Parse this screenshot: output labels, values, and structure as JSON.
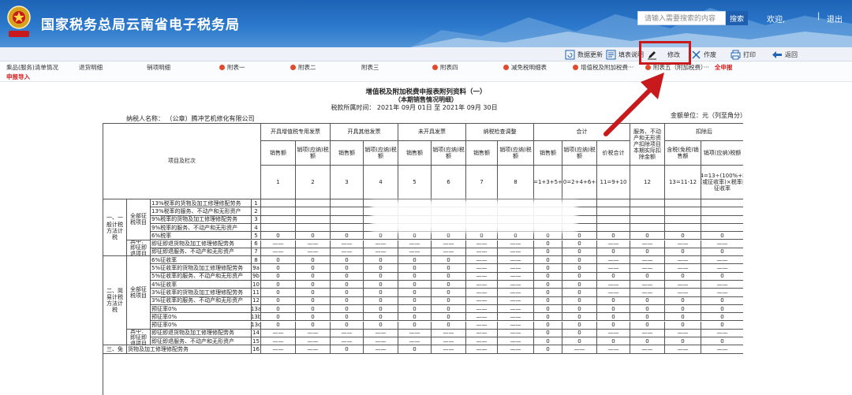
{
  "header": {
    "title": "国家税务总局云南省电子税务局",
    "search_placeholder": "请输入需要搜索的内容",
    "search_button": "搜索",
    "welcome": "欢迎,",
    "separator": "|",
    "logout": "退出",
    "colors": {
      "banner": "#2b78cc",
      "accent": "#c8191c"
    }
  },
  "toolbar": {
    "items": [
      {
        "label": "数据更新",
        "icon": "refresh-icon"
      },
      {
        "label": "填表说明",
        "icon": "doc-icon"
      },
      {
        "label": "修改",
        "icon": "edit-icon"
      },
      {
        "label": "作废",
        "icon": "void-icon"
      },
      {
        "label": "打印",
        "icon": "print-icon"
      },
      {
        "label": "返回",
        "icon": "back-icon"
      }
    ]
  },
  "tabs": {
    "items": [
      "乘品(服务)清单情况",
      "退货明细",
      "销项明细",
      "附表一",
      "附表二",
      "附表三",
      "附表四",
      "减免税明细表",
      "增值税及附加税费···",
      "附表五（附加税费）···",
      "全申报",
      "申报导入"
    ]
  },
  "document": {
    "title": "增值税及附加税费申报表附列资料（一）",
    "subtitle": "（本期销售情况明细）",
    "period": "税款所属时间： 2021年 09月 01日 至 2021年 09月 30日",
    "taxpayer": "纳税人名称： （公章）腾冲艺机修化有限公司",
    "unit": "金额单位：元（列至角分）"
  },
  "table": {
    "header_row1": [
      "开具增值税专用发票",
      "开具其他发票",
      "未开具发票",
      "纳税检查调整",
      "合计",
      "服务、不动产和无形资产扣除项目本期实际扣除金额",
      "扣除后"
    ],
    "header_row2": [
      "销售额",
      "销项(应纳)税额",
      "销售额",
      "销项(应纳)税额",
      "销售额",
      "销项(应纳)税额",
      "销售额",
      "销项(应纳)税额",
      "销售额",
      "销项(应纳)税额",
      "价税合计",
      "含税(免税)销售额",
      "销项(应纳)税额"
    ],
    "header_row3": [
      "1",
      "2",
      "3",
      "4",
      "5",
      "6",
      "7",
      "8",
      "9=1+3+5+7",
      "10=2+4+6+8",
      "11=9+10",
      "12",
      "13=11-12",
      "14=13÷(100%+税率或征收率)×税率或征收率"
    ],
    "project_header": "项目及栏次",
    "groups": [
      "一、一般计税方法计税",
      "二、简易计税方法计税",
      "三、免"
    ],
    "subgroups": [
      "全部征税项目",
      "其中：即征即退项目",
      "全部征税项目",
      "其中：即征即退项目"
    ],
    "rows": [
      {
        "label": "13%税率的货物及加工修理修配劳务",
        "no": "1",
        "cells": [
          "",
          "",
          "",
          "",
          "",
          "",
          "",
          "",
          "",
          "",
          "",
          "",
          "",
          ""
        ]
      },
      {
        "label": "13%税率的服务、不动产和无形资产",
        "no": "2",
        "cells": [
          "",
          "",
          "",
          "",
          "",
          "",
          "",
          "",
          "",
          "",
          "",
          "",
          "",
          ""
        ]
      },
      {
        "label": "9%税率的货物及加工修理修配劳务",
        "no": "3",
        "cells": [
          "",
          "",
          "",
          "",
          "",
          "",
          "",
          "",
          "",
          "",
          "",
          "",
          "",
          ""
        ]
      },
      {
        "label": "9%税率的服务、不动产和无形资产",
        "no": "4",
        "cells": [
          "",
          "",
          "",
          "",
          "",
          "",
          "",
          "",
          "",
          "",
          "",
          "",
          "",
          ""
        ]
      },
      {
        "label": "6%税率",
        "no": "5",
        "cells": [
          "0",
          "0",
          "0",
          "0",
          "0",
          "0",
          "0",
          "0",
          "0",
          "0",
          "0",
          "0",
          "0",
          "0"
        ]
      },
      {
        "label": "即征即退货物及加工修理修配劳务",
        "no": "6",
        "cells": [
          "——",
          "——",
          "——",
          "——",
          "——",
          "——",
          "——",
          "——",
          "0",
          "0",
          "——",
          "——",
          "——",
          "——"
        ]
      },
      {
        "label": "即征即退服务、不动产和无形资产",
        "no": "7",
        "cells": [
          "——",
          "——",
          "——",
          "——",
          "——",
          "——",
          "——",
          "——",
          "0",
          "0",
          "0",
          "0",
          "0",
          "0"
        ]
      },
      {
        "label": "6%征收率",
        "no": "8",
        "cells": [
          "0",
          "0",
          "0",
          "0",
          "0",
          "0",
          "——",
          "——",
          "0",
          "0",
          "——",
          "——",
          "——",
          "——"
        ]
      },
      {
        "label": "5%征收率的货物及加工修理修配劳务",
        "no": "9a",
        "cells": [
          "0",
          "0",
          "0",
          "0",
          "0",
          "0",
          "——",
          "——",
          "0",
          "0",
          "——",
          "——",
          "——",
          "——"
        ]
      },
      {
        "label": "5%征收率的服务、不动产和无形资产",
        "no": "9b",
        "cells": [
          "0",
          "0",
          "0",
          "0",
          "0",
          "0",
          "——",
          "——",
          "0",
          "0",
          "0",
          "0",
          "0",
          "0"
        ]
      },
      {
        "label": "4%征收率",
        "no": "10",
        "cells": [
          "0",
          "0",
          "0",
          "0",
          "0",
          "0",
          "——",
          "——",
          "0",
          "0",
          "——",
          "——",
          "——",
          "——"
        ]
      },
      {
        "label": "3%征收率的货物及加工修理修配劳务",
        "no": "11",
        "cells": [
          "0",
          "0",
          "0",
          "0",
          "0",
          "0",
          "——",
          "——",
          "0",
          "0",
          "——",
          "——",
          "——",
          "——"
        ]
      },
      {
        "label": "3%征收率的服务、不动产和无形资产",
        "no": "12",
        "cells": [
          "0",
          "0",
          "0",
          "0",
          "0",
          "0",
          "——",
          "——",
          "0",
          "0",
          "0",
          "0",
          "0",
          "0"
        ]
      },
      {
        "label": "预征率0%",
        "no": "13a",
        "cells": [
          "0",
          "0",
          "0",
          "0",
          "0",
          "0",
          "——",
          "——",
          "0",
          "0",
          "0",
          "0",
          "0",
          "0"
        ]
      },
      {
        "label": "预征率0%",
        "no": "13b",
        "cells": [
          "0",
          "0",
          "0",
          "0",
          "0",
          "0",
          "——",
          "——",
          "0",
          "0",
          "0",
          "0",
          "0",
          "0"
        ]
      },
      {
        "label": "预征率0%",
        "no": "13c",
        "cells": [
          "0",
          "0",
          "0",
          "0",
          "0",
          "0",
          "——",
          "——",
          "0",
          "0",
          "0",
          "0",
          "0",
          "0"
        ]
      },
      {
        "label": "即征即退货物及加工修理修配劳务",
        "no": "14",
        "cells": [
          "——",
          "——",
          "——",
          "——",
          "——",
          "——",
          "——",
          "——",
          "0",
          "0",
          "——",
          "——",
          "——",
          "——"
        ]
      },
      {
        "label": "即征即退服务、不动产和无形资产",
        "no": "15",
        "cells": [
          "——",
          "——",
          "——",
          "——",
          "——",
          "——",
          "——",
          "——",
          "0",
          "0",
          "0",
          "0",
          "0",
          "0"
        ]
      },
      {
        "label": "货物及加工修理修配劳务",
        "no": "16",
        "cells": [
          "——",
          "——",
          "0",
          "——",
          "0",
          "——",
          "——",
          "——",
          "0",
          "——",
          "——",
          "——",
          "——",
          "——"
        ]
      }
    ]
  }
}
